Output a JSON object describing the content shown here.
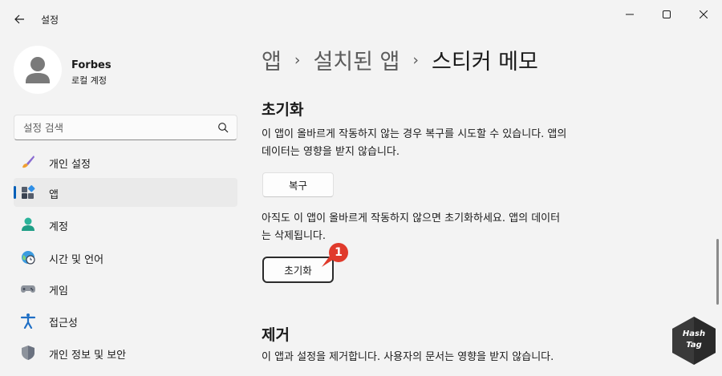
{
  "window": {
    "title": "설정",
    "controls": {
      "minimize": "minimize-icon",
      "maximize": "maximize-icon",
      "close": "close-icon"
    }
  },
  "profile": {
    "name": "Forbes",
    "account_type": "로컬 계정"
  },
  "search": {
    "placeholder": "설정 검색"
  },
  "sidebar": {
    "items": [
      {
        "label": "개인 설정",
        "icon": "brush-icon"
      },
      {
        "label": "앱",
        "icon": "apps-icon",
        "active": true
      },
      {
        "label": "계정",
        "icon": "person-icon"
      },
      {
        "label": "시간 및 언어",
        "icon": "globe-clock-icon"
      },
      {
        "label": "게임",
        "icon": "gamepad-icon"
      },
      {
        "label": "접근성",
        "icon": "accessibility-icon"
      },
      {
        "label": "개인 정보 및 보안",
        "icon": "shield-icon"
      }
    ]
  },
  "breadcrumb": {
    "part1": "앱",
    "part2": "설치된 앱",
    "current": "스티커 메모",
    "separator": "›"
  },
  "reset_section": {
    "title": "초기화",
    "repair_desc_line1": "이 앱이 올바르게 작동하지 않는 경우 복구를 시도할 수 있습니다. 앱의",
    "repair_desc_line2": "데이터는 영향을 받지 않습니다.",
    "repair_button": "복구",
    "reset_desc_line1": "아직도 이 앱이 올바르게 작동하지 않으면 초기화하세요. 앱의 데이터",
    "reset_desc_line2": "는 삭제됩니다.",
    "reset_button": "초기화",
    "marker": "1"
  },
  "remove_section": {
    "title": "제거",
    "desc": "이 앱과 설정을 제거합니다. 사용자의 문서는 영향을 받지 않습니다."
  },
  "watermark": {
    "line1": "Hash",
    "line2": "Tag"
  },
  "colors": {
    "accent": "#005fb8",
    "marker": "#e03a2b",
    "background": "#f3f3f3"
  }
}
